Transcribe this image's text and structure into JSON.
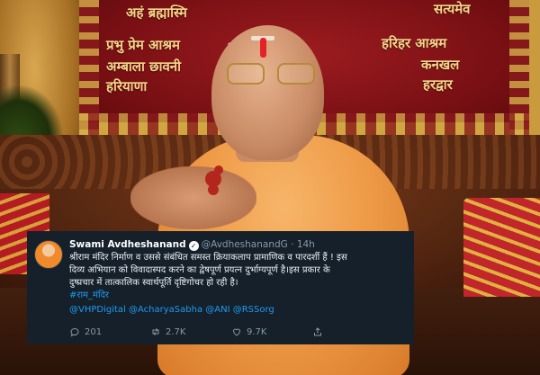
{
  "photo": {
    "banner_left_lines": [
      "अहं ब्रह्मास्मि",
      "प्रभु प्रेम आश्रम",
      "अम्बाला छावनी",
      "हरियाणा"
    ],
    "banner_center": "श्री",
    "banner_right_lines": [
      "सत्यमेव",
      "हरिहर आश्रम",
      "कनखल",
      "हरद्वार"
    ]
  },
  "tweet": {
    "display_name": "Swami Avdheshanand",
    "handle": "@AvdheshanandG",
    "time": "14h",
    "text_lines": [
      "श्रीराम मंदिर निर्माण व उससे संबंधित समस्त क्रियाकलाप प्रामाणिक व पारदर्शी हैं ! इस",
      "दिव्य अभियान को विवादास्पद करने का द्वेषपूर्ण प्रयत्न दुर्भाग्यपूर्ण है।इस प्रकार के",
      "दुष्प्रचार में तात्कालिक स्वार्थपूर्ति दृष्टिगोचर हो रही है।"
    ],
    "hashtag": "#राम_मंदिर",
    "mentions": "@VHPDigital @AcharyaSabha @ANI @RSSorg",
    "replies": "201",
    "retweets": "2.7K",
    "likes": "9.7K",
    "verified_icon": "verified-badge-icon",
    "colors": {
      "background": "#15202b",
      "link": "#1d9bf0",
      "muted": "#8899a6"
    }
  }
}
